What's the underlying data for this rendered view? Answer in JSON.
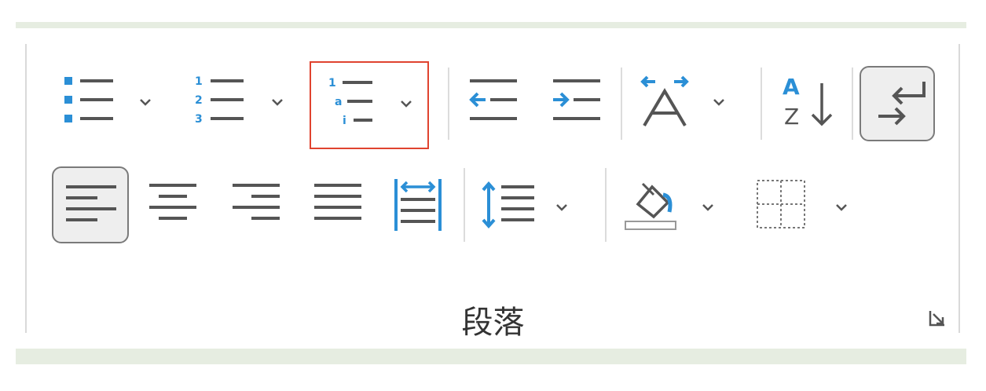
{
  "group": {
    "label": "段落"
  },
  "colors": {
    "accent": "#2b8fd6",
    "highlight": "#e0432f",
    "icon": "#555555"
  },
  "row1": [
    {
      "name": "bullets-button",
      "icon": "bullet-list-icon",
      "has_dropdown": true
    },
    {
      "name": "numbering-button",
      "icon": "numbered-list-icon",
      "has_dropdown": true,
      "marks": [
        "1",
        "2",
        "3"
      ]
    },
    {
      "name": "multilevel-list-button",
      "icon": "multilevel-list-icon",
      "has_dropdown": true,
      "highlighted": true,
      "marks": [
        "1",
        "a",
        "i"
      ]
    },
    {
      "name": "decrease-indent-button",
      "icon": "decrease-indent-icon"
    },
    {
      "name": "increase-indent-button",
      "icon": "increase-indent-icon"
    },
    {
      "name": "character-spacing-button",
      "icon": "character-spacing-icon",
      "has_dropdown": true
    },
    {
      "name": "sort-button",
      "icon": "sort-az-icon",
      "marks": [
        "A",
        "Z"
      ]
    },
    {
      "name": "show-formatting-marks-button",
      "icon": "paragraph-mark-icon",
      "pressed": true
    }
  ],
  "row2": [
    {
      "name": "align-left-button",
      "icon": "align-left-icon",
      "pressed": true
    },
    {
      "name": "align-center-button",
      "icon": "align-center-icon"
    },
    {
      "name": "align-right-button",
      "icon": "align-right-icon"
    },
    {
      "name": "justify-button",
      "icon": "justify-icon"
    },
    {
      "name": "distributed-button",
      "icon": "distributed-icon"
    },
    {
      "name": "line-spacing-button",
      "icon": "line-spacing-icon",
      "has_dropdown": true
    },
    {
      "name": "shading-button",
      "icon": "paint-bucket-icon",
      "has_dropdown": true
    },
    {
      "name": "borders-button",
      "icon": "borders-icon",
      "has_dropdown": true
    }
  ]
}
